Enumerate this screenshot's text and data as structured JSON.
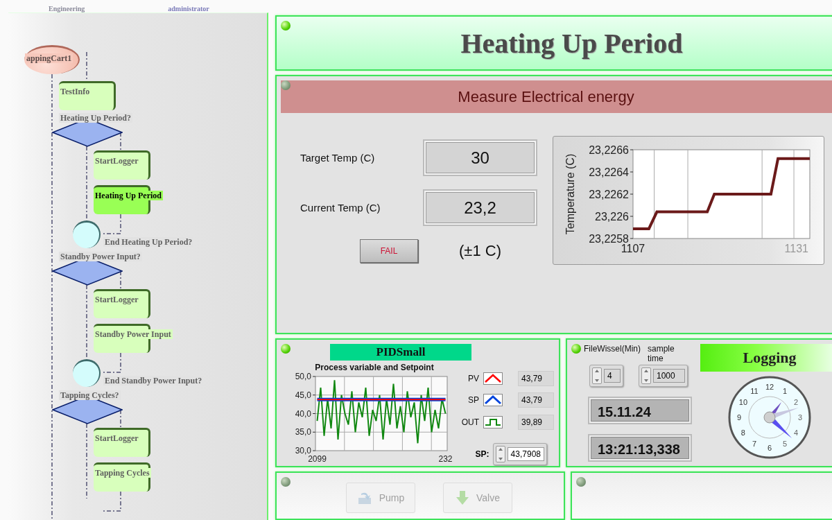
{
  "top_bar": {
    "left_text": "Engineering",
    "right_text": "administrator"
  },
  "flowchart": {
    "nodes": [
      {
        "kind": "start",
        "label": "appingCart1"
      },
      {
        "kind": "process",
        "label": "TestInfo",
        "active": false
      },
      {
        "kind": "decision",
        "label": "Heating Up Period?",
        "children": [
          {
            "kind": "process",
            "label": "StartLogger",
            "active": false
          },
          {
            "kind": "process",
            "label": "Heating Up Period",
            "active": true
          }
        ]
      },
      {
        "kind": "junction",
        "label": "End Heating Up Period?"
      },
      {
        "kind": "decision",
        "label": "Standby Power Input?",
        "children": [
          {
            "kind": "process",
            "label": "StartLogger",
            "active": false
          },
          {
            "kind": "process",
            "label": "Standby Power Input",
            "active": false
          }
        ]
      },
      {
        "kind": "junction",
        "label": "End Standby Power Input?"
      },
      {
        "kind": "decision",
        "label": "Tapping Cycles?",
        "children": [
          {
            "kind": "process",
            "label": "StartLogger",
            "active": false
          },
          {
            "kind": "process",
            "label": "Tapping Cycles",
            "active": false
          }
        ]
      }
    ]
  },
  "header": {
    "led_on": true,
    "title": "Heating Up Period"
  },
  "measure": {
    "led_on": false,
    "title": "Measure Electrical energy",
    "target_label": "Target Temp (C)",
    "target_value": "30",
    "current_label": "Current Temp (C)",
    "current_value": "23,2",
    "status_button": "FAIL",
    "tolerance": "(±1 C)",
    "chart": {
      "y_axis_title": "Temperature (C)",
      "y_tick_labels": [
        "23,2266",
        "23,2264",
        "23,2262",
        "23,226",
        "23,2258"
      ],
      "x_tick_labels": [
        "1107",
        "1131"
      ]
    }
  },
  "pid": {
    "led_on": true,
    "title": "PIDSmall",
    "chart_data": {
      "type": "line",
      "title": "Process variable and Setpoint",
      "categories": [
        "2099",
        null,
        null,
        null,
        null,
        null,
        null,
        null,
        null,
        null,
        null,
        null,
        null,
        null,
        null,
        null,
        null,
        null,
        null,
        null,
        null,
        null,
        null,
        null,
        null,
        null,
        null,
        null,
        null,
        null,
        null,
        null,
        null,
        null,
        null,
        null,
        null,
        "232"
      ],
      "series": [
        {
          "name": "PV",
          "color": "#ff0000",
          "values": [
            43.79,
            43.79,
            43.79,
            43.79,
            43.79,
            43.79,
            43.79,
            43.79,
            43.79,
            43.79,
            43.79,
            43.79,
            43.79,
            43.79,
            43.79,
            43.79,
            43.79,
            43.79,
            43.79,
            43.79,
            43.79,
            43.79,
            43.79,
            43.79,
            43.79,
            43.79,
            43.79,
            43.79,
            43.79,
            43.79,
            43.79,
            43.79,
            43.79,
            43.79,
            43.79,
            43.79,
            43.79,
            43.79
          ]
        },
        {
          "name": "SP",
          "color": "#0044dd",
          "values": [
            43.79,
            43.79,
            43.79,
            43.79,
            43.79,
            43.79,
            43.79,
            43.79,
            43.79,
            43.79,
            43.79,
            43.79,
            43.79,
            43.79,
            43.79,
            43.79,
            43.79,
            43.79,
            43.79,
            43.79,
            43.79,
            43.79,
            43.79,
            43.79,
            43.79,
            43.79,
            43.79,
            43.79,
            43.79,
            43.79,
            43.79,
            43.79,
            43.79,
            43.79,
            43.79,
            43.79,
            43.79,
            43.79
          ]
        },
        {
          "name": "OUT",
          "color": "#118811",
          "values": [
            38,
            47,
            34,
            44,
            36,
            49,
            33,
            45,
            40,
            37,
            46,
            35,
            43,
            39,
            47,
            34,
            41,
            38,
            45,
            33,
            44,
            37,
            48,
            36,
            42,
            35,
            46,
            39,
            43,
            32,
            45,
            38,
            47,
            35,
            41,
            36,
            44,
            40
          ]
        }
      ],
      "ylim": [
        30,
        50
      ],
      "grid": true,
      "yticks": [
        {
          "value": 50,
          "label": "50,0"
        },
        {
          "value": 45,
          "label": "45,0"
        },
        {
          "value": 40,
          "label": "40,0"
        },
        {
          "value": 35,
          "label": "35,0"
        },
        {
          "value": 30,
          "label": "30,0"
        }
      ]
    },
    "legend": [
      {
        "kind": "line",
        "value": "43,79"
      },
      {
        "kind": "line",
        "value": "43,79"
      },
      {
        "kind": "step",
        "value": "39,89"
      }
    ],
    "setpoint_label": "SP:",
    "setpoint_value": "43,7908"
  },
  "logging": {
    "led_on": true,
    "file_label": "FileWissel(Min)",
    "file_value": "4",
    "sample_label": "sample time",
    "sample_value": "1000",
    "date": "15.11.24",
    "time": "13:21:13,338",
    "status": "Logging",
    "clock_numbers": [
      "12",
      "1",
      "2",
      "3",
      "4",
      "5",
      "6",
      "7",
      "8",
      "9",
      "10",
      "11"
    ]
  },
  "actions": {
    "led_on": false,
    "buttons": [
      {
        "label": "Pump",
        "kind": "pump",
        "disabled": true
      },
      {
        "label": "Valve",
        "kind": "valve",
        "disabled": true
      }
    ]
  },
  "spare": {
    "led_on": false
  }
}
